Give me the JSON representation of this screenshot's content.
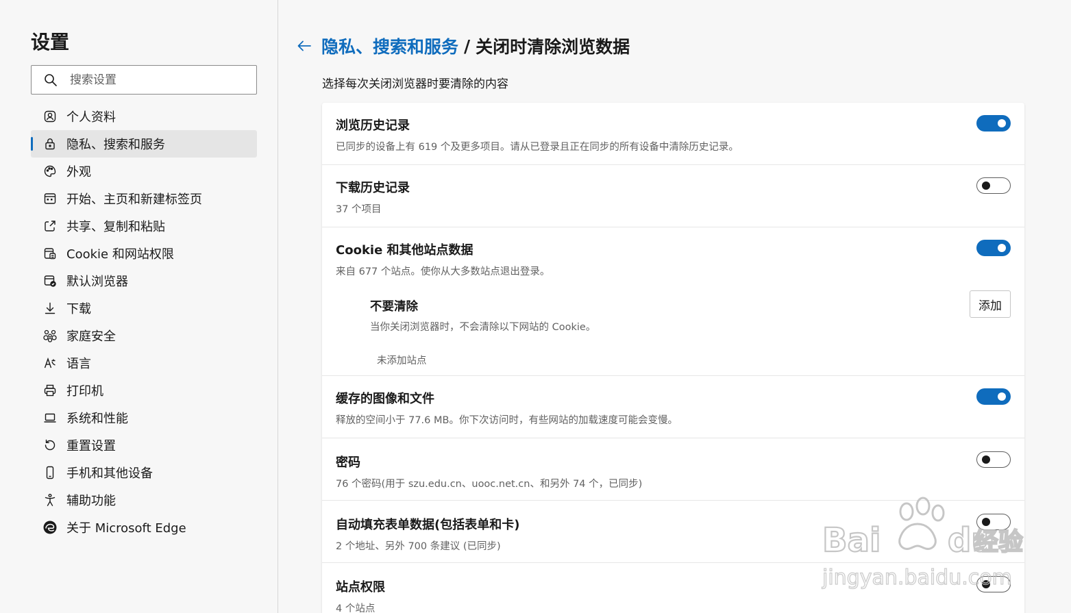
{
  "sidebar": {
    "title": "设置",
    "search_placeholder": "搜索设置",
    "items": [
      {
        "label": "个人资料",
        "icon": "profile-icon"
      },
      {
        "label": "隐私、搜索和服务",
        "icon": "lock-icon",
        "active": true
      },
      {
        "label": "外观",
        "icon": "palette-icon"
      },
      {
        "label": "开始、主页和新建标签页",
        "icon": "home-tab-icon"
      },
      {
        "label": "共享、复制和粘贴",
        "icon": "share-icon"
      },
      {
        "label": "Cookie 和网站权限",
        "icon": "site-permissions-icon"
      },
      {
        "label": "默认浏览器",
        "icon": "default-browser-icon"
      },
      {
        "label": "下载",
        "icon": "download-icon"
      },
      {
        "label": "家庭安全",
        "icon": "family-icon"
      },
      {
        "label": "语言",
        "icon": "language-icon"
      },
      {
        "label": "打印机",
        "icon": "printer-icon"
      },
      {
        "label": "系统和性能",
        "icon": "laptop-icon"
      },
      {
        "label": "重置设置",
        "icon": "reset-icon"
      },
      {
        "label": "手机和其他设备",
        "icon": "phone-icon"
      },
      {
        "label": "辅助功能",
        "icon": "accessibility-icon"
      },
      {
        "label": "关于 Microsoft Edge",
        "icon": "edge-icon"
      }
    ]
  },
  "header": {
    "parent": "隐私、搜索和服务",
    "separator": "/",
    "current": "关闭时清除浏览数据"
  },
  "intro": "选择每次关闭浏览器时要清除的内容",
  "rows": [
    {
      "title": "浏览历史记录",
      "desc": "已同步的设备上有 619 个及更多项目。请从已登录且正在同步的所有设备中清除历史记录。",
      "on": true
    },
    {
      "title": "下载历史记录",
      "desc": "37 个项目",
      "on": false
    },
    {
      "title": "Cookie 和其他站点数据",
      "desc": "来自 677 个站点。使你从大多数站点退出登录。",
      "on": true
    },
    {
      "title": "缓存的图像和文件",
      "desc": "释放的空间小于 77.6 MB。你下次访问时，有些网站的加载速度可能会变慢。",
      "on": true
    },
    {
      "title": "密码",
      "desc": "76 个密码(用于 szu.edu.cn、uooc.net.cn、和另外 74 个，已同步)",
      "on": false
    },
    {
      "title": "自动填充表单数据(包括表单和卡)",
      "desc": "2 个地址、另外 700 条建议 (已同步)",
      "on": false
    },
    {
      "title": "站点权限",
      "desc": "4 个站点",
      "on": false
    }
  ],
  "dont_clear": {
    "title": "不要清除",
    "desc": "当你关闭浏览器时，不会清除以下网站的 Cookie。",
    "add_label": "添加",
    "empty": "未添加站点"
  },
  "watermark": {
    "brand": "Bai",
    "brand2": "du",
    "suffix": "经验",
    "url": "jingyan.baidu.com"
  },
  "colors": {
    "accent": "#0f6cbd",
    "background": "#f7f7f7",
    "card": "#ffffff",
    "secondary_text": "#616161"
  }
}
